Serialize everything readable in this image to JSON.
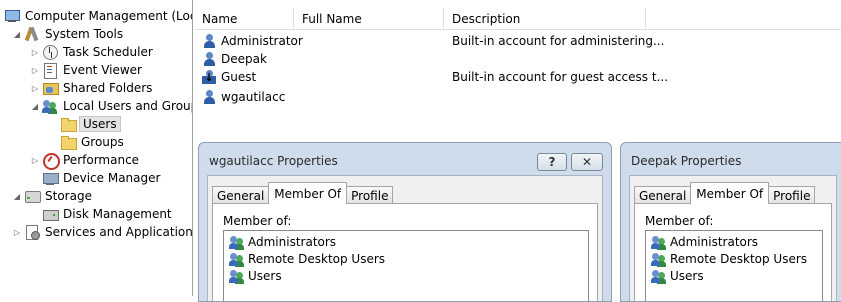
{
  "tree": {
    "items": [
      {
        "label": "Computer Management (Local",
        "icon": "computer-icon"
      },
      {
        "label": "System Tools",
        "icon": "tools-icon"
      },
      {
        "label": "Task Scheduler",
        "icon": "clock-icon"
      },
      {
        "label": "Event Viewer",
        "icon": "event-viewer-icon"
      },
      {
        "label": "Shared Folders",
        "icon": "shared-folder-icon"
      },
      {
        "label": "Local Users and Groups",
        "icon": "users-group-icon"
      },
      {
        "label": "Users",
        "icon": "folder-icon"
      },
      {
        "label": "Groups",
        "icon": "folder-icon"
      },
      {
        "label": "Performance",
        "icon": "performance-icon"
      },
      {
        "label": "Device Manager",
        "icon": "device-manager-icon"
      },
      {
        "label": "Storage",
        "icon": "storage-icon"
      },
      {
        "label": "Disk Management",
        "icon": "disk-icon"
      },
      {
        "label": "Services and Applications",
        "icon": "services-icon"
      }
    ]
  },
  "list": {
    "columns": [
      "Name",
      "Full Name",
      "Description"
    ],
    "rows": [
      {
        "name": "Administrator",
        "full_name": "",
        "description": "Built-in account for administering..."
      },
      {
        "name": "Deepak",
        "full_name": "",
        "description": ""
      },
      {
        "name": "Guest",
        "full_name": "",
        "description": "Built-in account for guest access t..."
      },
      {
        "name": "wgautilacc",
        "full_name": "",
        "description": ""
      }
    ]
  },
  "dialog1": {
    "title": "wgautilacc Properties",
    "help_label": "?",
    "close_label": "✕",
    "tabs": [
      "General",
      "Member Of",
      "Profile"
    ],
    "member_of_label": "Member of:",
    "members": [
      "Administrators",
      "Remote Desktop Users",
      "Users"
    ]
  },
  "dialog2": {
    "title": "Deepak Properties",
    "tabs": [
      "General",
      "Member Of",
      "Profile"
    ],
    "member_of_label": "Member of:",
    "members": [
      "Administrators",
      "Remote Desktop Users",
      "Users"
    ]
  }
}
